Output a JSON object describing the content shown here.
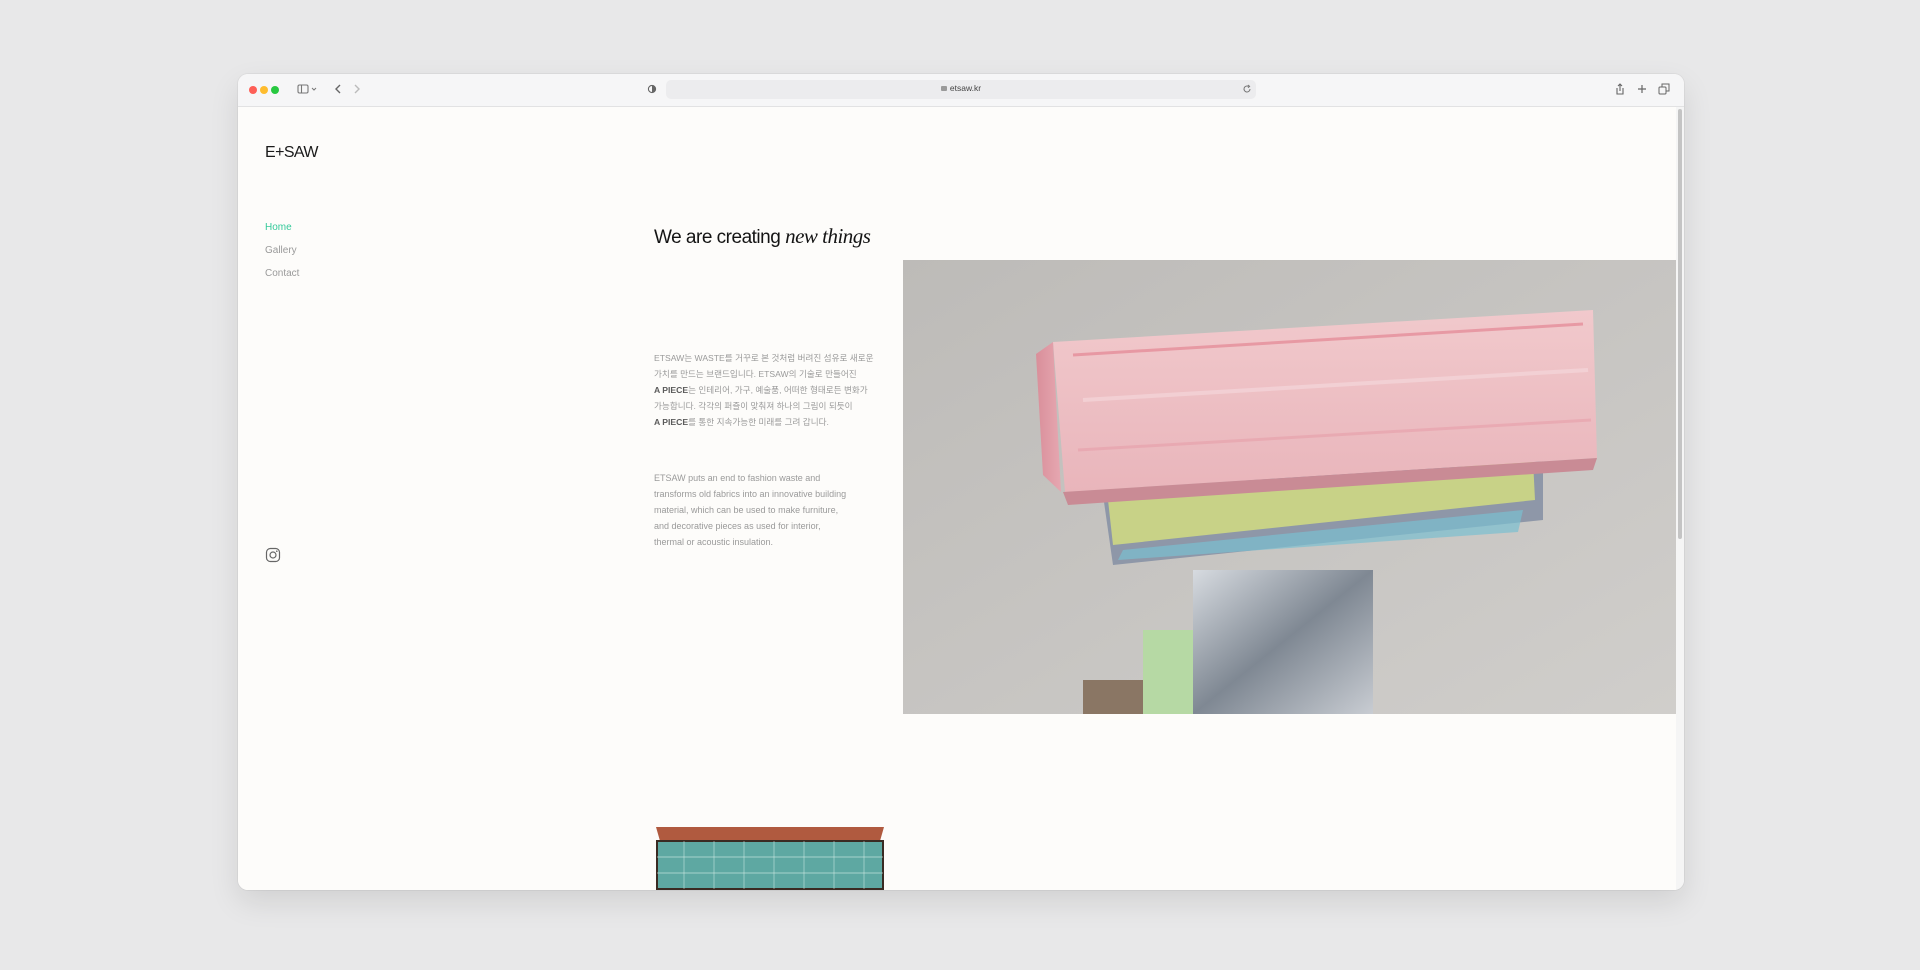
{
  "browser": {
    "url": "etsaw.kr",
    "icons": [
      "sidebar-icon",
      "chevron-down-icon",
      "back-icon",
      "forward-icon",
      "shield-icon",
      "lock-icon",
      "reload-icon",
      "share-icon",
      "new-tab-icon",
      "tabs-icon"
    ]
  },
  "site": {
    "logo_text": "E+SAW",
    "nav": [
      {
        "label": "Home",
        "active": true
      },
      {
        "label": "Gallery",
        "active": false
      },
      {
        "label": "Contact",
        "active": false
      }
    ],
    "social_icon": "instagram-icon"
  },
  "content": {
    "headline_plain": "We are creating ",
    "headline_italic": "new things",
    "kr_para": {
      "line1": "ETSAW는 WASTE를 거꾸로 본 것처럼 버려진 섬유로 새로운",
      "line2": "가치를 만드는 브랜드입니다. ETSAW의 기술로 만들어진",
      "line3_bold": "A PIECE",
      "line3_rest": "는 인테리어, 가구, 예술품, 어떠한 형태로든 변화가",
      "line4": "가능합니다. 각각의 퍼즐이 맞춰져 하나의 그림이 되듯이",
      "line5_bold": "A PIECE",
      "line5_rest": "를 통한 지속가능한 미래를 그려 갑니다."
    },
    "en_para": {
      "line1": "ETSAW puts an end to fashion waste and",
      "line2": "transforms old fabrics into an innovative building",
      "line3": "material, which can be used to make furniture,",
      "line4": "and decorative pieces as used for interior,",
      "line5": "thermal or acoustic insulation."
    }
  },
  "colors": {
    "accent": "#34c99a",
    "background": "#fdfcfa",
    "text_muted": "#9a9a9a"
  }
}
